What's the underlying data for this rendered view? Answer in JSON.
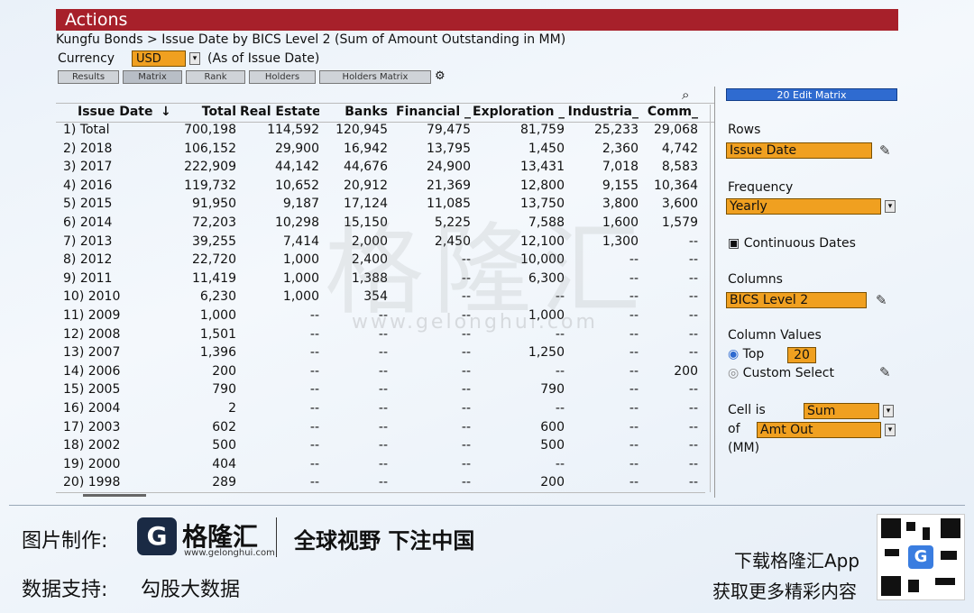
{
  "window": {
    "title": "Actions"
  },
  "breadcrumb": "Kungfu Bonds > Issue Date by BICS Level 2 (Sum of Amount Outstanding in MM)",
  "currency": {
    "label": "Currency",
    "value": "USD",
    "as_of": "(As of Issue Date)"
  },
  "tabs": [
    {
      "label": "Results"
    },
    {
      "label": "Matrix",
      "active": true
    },
    {
      "label": "Rank"
    },
    {
      "label": "Holders"
    },
    {
      "label": "Holders Matrix"
    }
  ],
  "icons": {
    "settings": "gear-icon",
    "magnify": "magnify-icon",
    "edit": "pencil-icon"
  },
  "table": {
    "columns": [
      "Issue Date",
      "Total",
      "Real Estate",
      "Banks",
      "Financial _",
      "Exploration _",
      "Industria_",
      "Comm_"
    ],
    "sort_indicator": "↓",
    "rows": [
      [
        "1) Total",
        "700,198",
        "114,592",
        "120,945",
        "79,475",
        "81,759",
        "25,233",
        "29,068"
      ],
      [
        "2) 2018",
        "106,152",
        "29,900",
        "16,942",
        "13,795",
        "1,450",
        "2,360",
        "4,742"
      ],
      [
        "3) 2017",
        "222,909",
        "44,142",
        "44,676",
        "24,900",
        "13,431",
        "7,018",
        "8,583"
      ],
      [
        "4) 2016",
        "119,732",
        "10,652",
        "20,912",
        "21,369",
        "12,800",
        "9,155",
        "10,364"
      ],
      [
        "5) 2015",
        "91,950",
        "9,187",
        "17,124",
        "11,085",
        "13,750",
        "3,800",
        "3,600"
      ],
      [
        "6) 2014",
        "72,203",
        "10,298",
        "15,150",
        "5,225",
        "7,588",
        "1,600",
        "1,579"
      ],
      [
        "7) 2013",
        "39,255",
        "7,414",
        "2,000",
        "2,450",
        "12,100",
        "1,300",
        "--"
      ],
      [
        "8) 2012",
        "22,720",
        "1,000",
        "2,400",
        "--",
        "10,000",
        "--",
        "--"
      ],
      [
        "9) 2011",
        "11,419",
        "1,000",
        "1,388",
        "--",
        "6,300",
        "--",
        "--"
      ],
      [
        "10) 2010",
        "6,230",
        "1,000",
        "354",
        "--",
        "--",
        "--",
        "--"
      ],
      [
        "11) 2009",
        "1,000",
        "--",
        "--",
        "--",
        "1,000",
        "--",
        "--"
      ],
      [
        "12) 2008",
        "1,501",
        "--",
        "--",
        "--",
        "--",
        "--",
        "--"
      ],
      [
        "13) 2007",
        "1,396",
        "--",
        "--",
        "--",
        "1,250",
        "--",
        "--"
      ],
      [
        "14) 2006",
        "200",
        "--",
        "--",
        "--",
        "--",
        "--",
        "200"
      ],
      [
        "15) 2005",
        "790",
        "--",
        "--",
        "--",
        "790",
        "--",
        "--"
      ],
      [
        "16) 2004",
        "2",
        "--",
        "--",
        "--",
        "--",
        "--",
        "--"
      ],
      [
        "17) 2003",
        "602",
        "--",
        "--",
        "--",
        "600",
        "--",
        "--"
      ],
      [
        "18) 2002",
        "500",
        "--",
        "--",
        "--",
        "500",
        "--",
        "--"
      ],
      [
        "19) 2000",
        "404",
        "--",
        "--",
        "--",
        "--",
        "--",
        "--"
      ],
      [
        "20) 1998",
        "289",
        "--",
        "--",
        "--",
        "200",
        "--",
        "--"
      ]
    ]
  },
  "side_panel": {
    "edit_button": "20 Edit Matrix",
    "rows_label": "Rows",
    "rows_value": "Issue Date",
    "frequency_label": "Frequency",
    "frequency_value": "Yearly",
    "continuous_dates": "Continuous Dates",
    "columns_label": "Columns",
    "columns_value": "BICS Level 2",
    "column_values_label": "Column Values",
    "top_label": "Top",
    "top_value": "20",
    "custom_select": "Custom Select",
    "cell_is_label": "Cell is",
    "cell_is_value": "Sum",
    "of_label": "of",
    "of_value": "Amt Out",
    "unit": "(MM)"
  },
  "watermark": {
    "text": "格隆汇",
    "url": "www.gelonghui.com"
  },
  "footer": {
    "made_by_label": "图片制作:",
    "logo_text": "格隆汇",
    "logo_url": "www.gelonghui.com",
    "slogan": "全球视野 下注中国",
    "data_support_label": "数据支持:",
    "data_support_value": "勾股大数据",
    "download": "下载格隆汇App",
    "more": "获取更多精彩内容",
    "logo_glyph": "G"
  },
  "colors": {
    "title_bar": "#a7202a",
    "highlight": "#f0a020",
    "button_blue": "#2f6bd0"
  }
}
